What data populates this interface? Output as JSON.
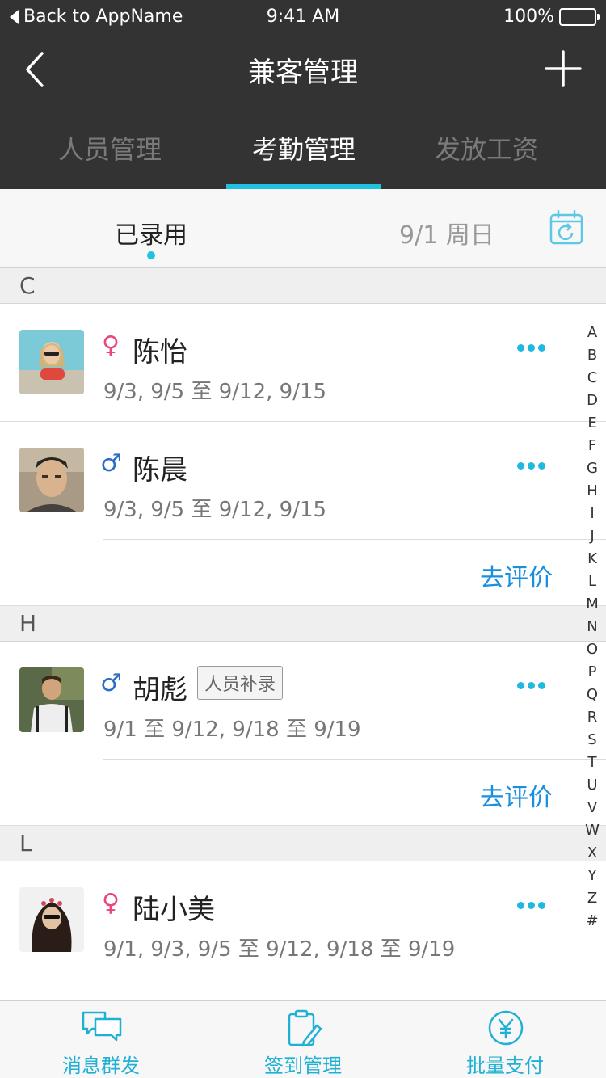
{
  "status_bar": {
    "back_text": "Back to AppName",
    "time": "9:41 AM",
    "battery": "100%"
  },
  "nav": {
    "title": "兼客管理"
  },
  "tabs": [
    {
      "label": "人员管理",
      "active": false
    },
    {
      "label": "考勤管理",
      "active": true
    },
    {
      "label": "发放工资",
      "active": false
    }
  ],
  "subbar": {
    "hired_label": "已录用",
    "date": "9/1 周日"
  },
  "sections": [
    {
      "letter": "C"
    },
    {
      "letter": "H"
    },
    {
      "letter": "L"
    }
  ],
  "people": [
    {
      "name": "陈怡",
      "gender_symbol": "♀",
      "dates": "9/3, 9/5 至 9/12, 9/15"
    },
    {
      "name": "陈晨",
      "gender_symbol": "♂",
      "dates": "9/3, 9/5 至 9/12, 9/15",
      "review": "去评价"
    },
    {
      "name": "胡彪",
      "gender_symbol": "♂",
      "tag": "人员补录",
      "dates": "9/1 至 9/12, 9/18 至 9/19",
      "review": "去评价"
    },
    {
      "name": "陆小美",
      "gender_symbol": "♀",
      "dates": "9/1, 9/3, 9/5 至 9/12, 9/18 至 9/19"
    }
  ],
  "index_letters": [
    "A",
    "B",
    "C",
    "D",
    "E",
    "F",
    "G",
    "H",
    "I",
    "J",
    "K",
    "L",
    "M",
    "N",
    "O",
    "P",
    "Q",
    "R",
    "S",
    "T",
    "U",
    "V",
    "W",
    "X",
    "Y",
    "Z",
    "#"
  ],
  "bottom_bar": [
    {
      "label": "消息群发",
      "icon": "chat-bubbles-icon"
    },
    {
      "label": "签到管理",
      "icon": "clipboard-pen-icon"
    },
    {
      "label": "批量支付",
      "icon": "yen-coin-icon"
    }
  ],
  "colors": {
    "accent": "#1fc3e0",
    "link": "#1a8fe0",
    "female": "#e8487a",
    "male": "#2b6cc4",
    "header_bg": "#333333"
  }
}
